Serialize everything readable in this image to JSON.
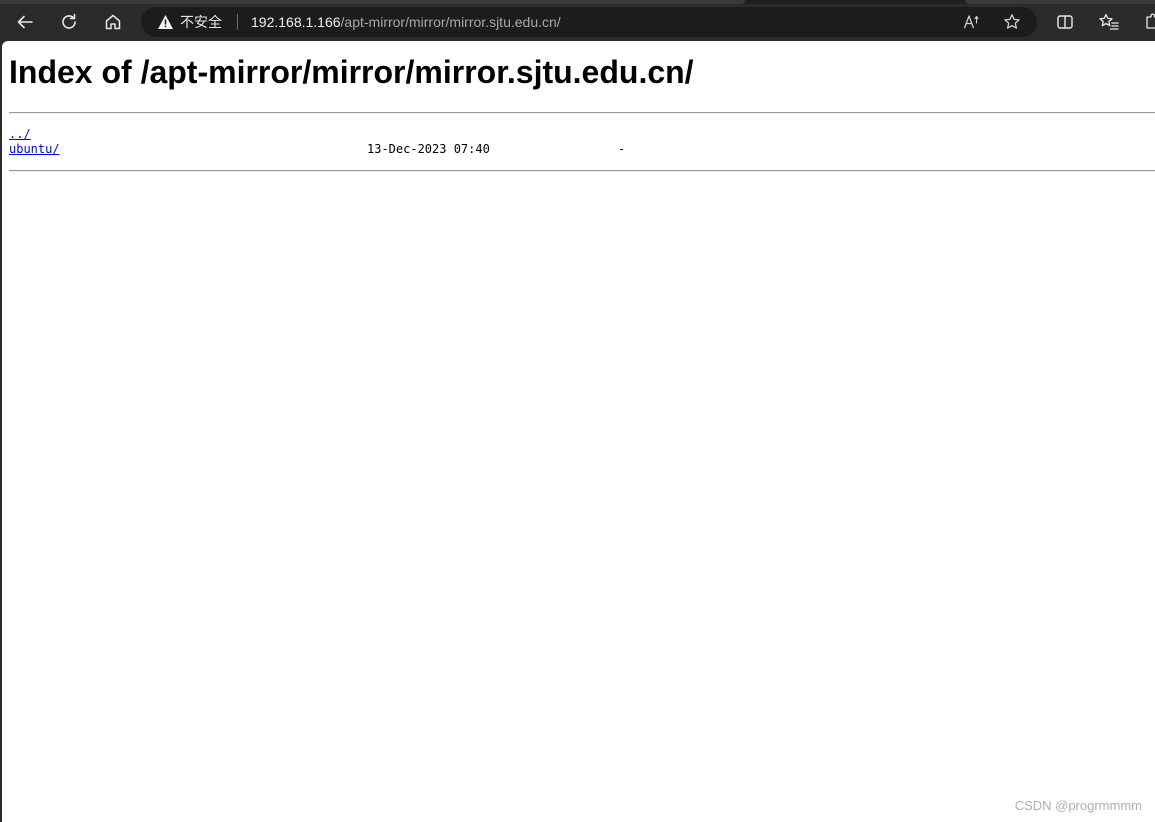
{
  "browser": {
    "security_label": "不安全",
    "url_host": "192.168.1.166",
    "url_path": "/apt-mirror/mirror/mirror.sjtu.edu.cn/",
    "icons": {
      "back": "back-arrow-icon",
      "reload": "reload-icon",
      "home": "home-icon",
      "warning": "warning-icon",
      "read_aloud": "read-aloud-icon",
      "favorite": "star-icon",
      "split_screen": "split-screen-icon",
      "favorites_list": "favorites-list-icon",
      "extensions": "extensions-icon"
    }
  },
  "page": {
    "title": "Index of /apt-mirror/mirror/mirror.sjtu.edu.cn/",
    "entries": [
      {
        "name": "../",
        "date": "",
        "size": ""
      },
      {
        "name": "ubuntu/",
        "date": "13-Dec-2023 07:40",
        "size": "-"
      }
    ]
  },
  "watermark": "CSDN @progrmmmm"
}
